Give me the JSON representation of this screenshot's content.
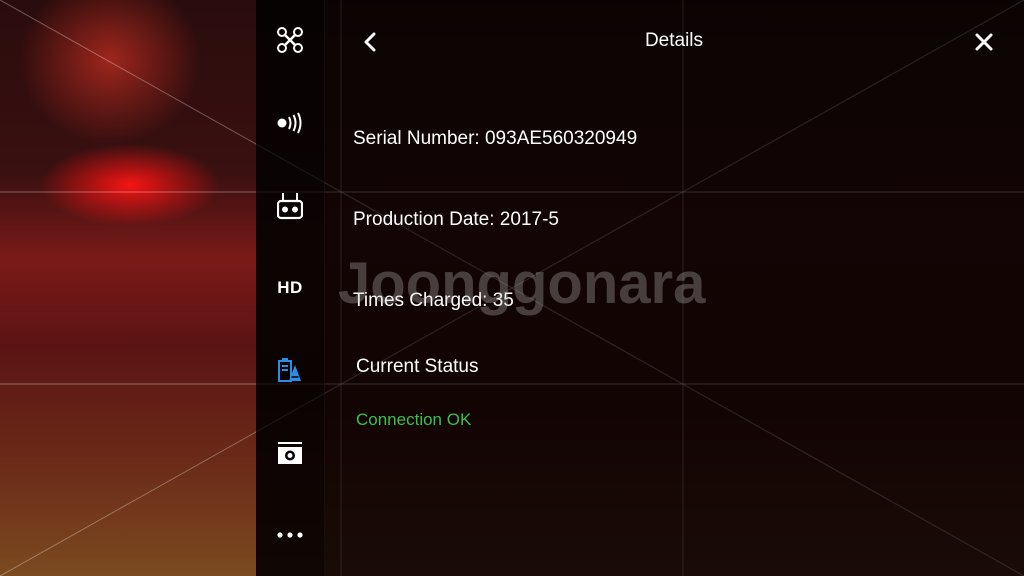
{
  "sidebar": {
    "items": [
      {
        "name": "aircraft",
        "icon": "drone-icon"
      },
      {
        "name": "signal",
        "icon": "wifi-broadcast-icon"
      },
      {
        "name": "remote-controller",
        "icon": "remote-controller-icon"
      },
      {
        "name": "hd",
        "label": "HD"
      },
      {
        "name": "battery",
        "icon": "battery-status-icon",
        "active": true
      },
      {
        "name": "camera",
        "icon": "camera-icon"
      },
      {
        "name": "more",
        "icon": "more-dots-icon"
      }
    ],
    "active_color": "#2a8ee8"
  },
  "panel": {
    "title": "Details",
    "serial_number": "Serial Number: 093AE560320949",
    "production_date": "Production Date: 2017-5",
    "times_charged": "Times Charged: 35",
    "status_heading": "Current Status",
    "status_value": "Connection OK",
    "status_color": "#3bbf4a"
  },
  "watermark": "Joonggonara"
}
